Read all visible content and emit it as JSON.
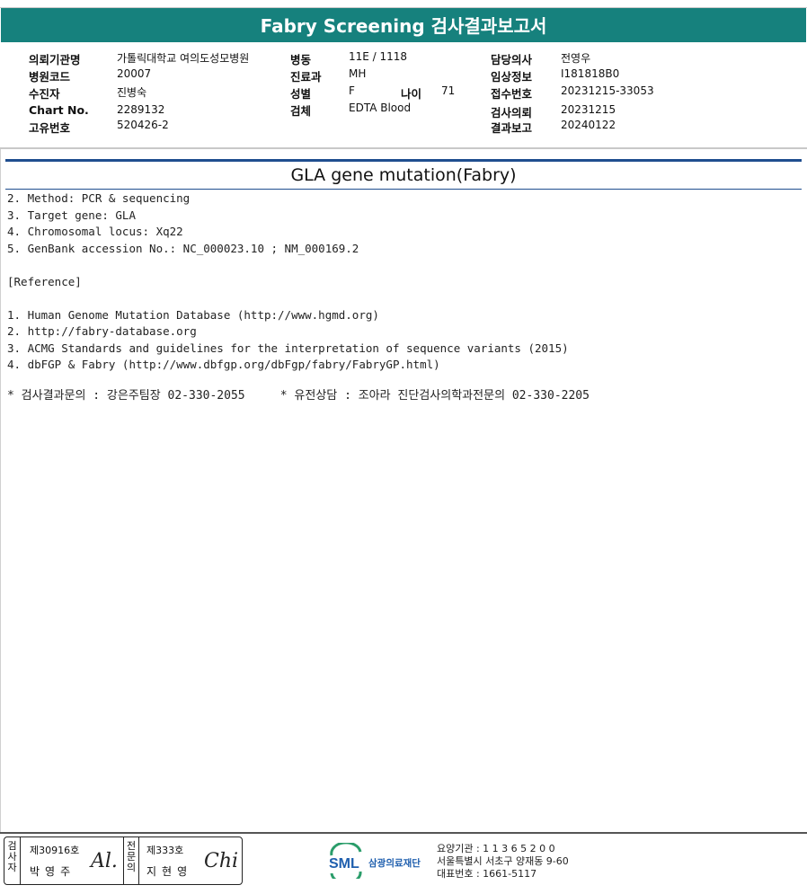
{
  "report": {
    "title": "Fabry Screening 검사결과보고서",
    "section_title": "GLA gene mutation(Fabry)"
  },
  "patient_info": {
    "institution_label": "의뢰기관명",
    "institution_value": "가톨릭대학교 여의도성모병원",
    "hospital_code_label": "병원코드",
    "hospital_code_value": "20007",
    "patient_label": "수진자",
    "patient_value": "진병숙",
    "chart_label": "Chart No.",
    "chart_value": "2289132",
    "unique_label": "고유번호",
    "unique_value": "520426-2",
    "ward_label": "병동",
    "ward_value": "11E / 1118",
    "dept_label": "진료과",
    "dept_value": "MH",
    "sex_label": "성별",
    "sex_value": "F",
    "age_label": "나이",
    "age_value": "71",
    "specimen_label": "검체",
    "specimen_value": "EDTA Blood",
    "doctor_label": "담당의사",
    "doctor_value": "전영우",
    "clinical_label": "임상정보",
    "clinical_value": "I181818B0",
    "receipt_label": "접수번호",
    "receipt_value": "20231215-33053",
    "request_label": "검사의뢰",
    "request_value": "20231215",
    "result_label": "결과보고",
    "result_value": "20240122"
  },
  "body": {
    "line1": "2. Method: PCR & sequencing",
    "line2": "3. Target gene: GLA",
    "line3": "4. Chromosomal locus: Xq22",
    "line4": "5. GenBank accession No.: NC_000023.10 ; NM_000169.2",
    "line5": "",
    "line6": "[Reference]",
    "line7": "",
    "line8": "1. Human Genome Mutation Database (http://www.hgmd.org)",
    "line9": "2. http://fabry-database.org",
    "line10": "3. ACMG Standards and guidelines for the interpretation of sequence variants (2015)",
    "line11": "4. dbFGP & Fabry (http://www.dbfgp.org/dbFgp/fabry/FabryGP.html)"
  },
  "contact": "* 검사결과문의 : 강은주팀장 02-330-2055     * 유전상담 : 조아라 진단검사의학과전문의 02-330-2205",
  "signatures": {
    "tester_label": "검사자",
    "tester_no": "제30916호",
    "tester_name": "박영주",
    "tester_sig": "Al.",
    "specialist_label": "전문의",
    "specialist_no": "제333호",
    "specialist_name": "지현영",
    "specialist_sig": "Chi"
  },
  "footer": {
    "logo_text": "SML",
    "org_name": "삼광의료재단",
    "code_line": "요양기관 : 1 1 3 6 5 2 0 0",
    "address_line": "서울특별시 서초구 양재동 9-60",
    "phone_line": "대표번호 : 1661-5117"
  },
  "colors": {
    "title_bar": "#16817d",
    "rule": "#1f4e8f",
    "logo_blue": "#1f5fae",
    "logo_green": "#2a9d6a"
  }
}
